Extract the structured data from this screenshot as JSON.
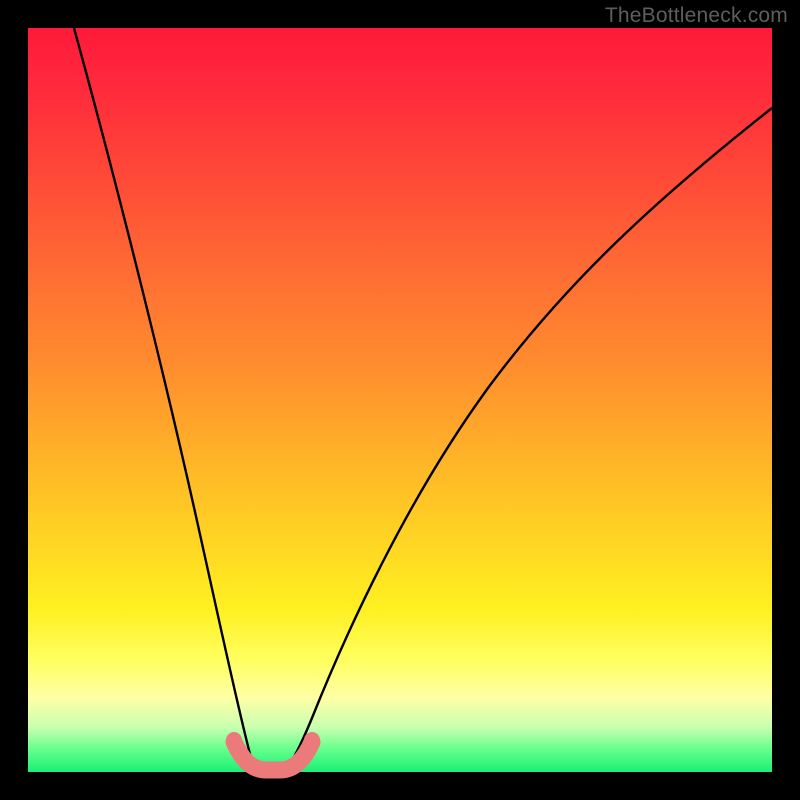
{
  "watermark": "TheBottleneck.com",
  "chart_data": {
    "type": "line",
    "title": "",
    "xlabel": "",
    "ylabel": "",
    "xlim": [
      0,
      1
    ],
    "ylim": [
      0,
      1
    ],
    "series": [
      {
        "name": "left-curve",
        "x": [
          0.06,
          0.09,
          0.12,
          0.15,
          0.18,
          0.21,
          0.235,
          0.26,
          0.28,
          0.295
        ],
        "y": [
          1.0,
          0.83,
          0.66,
          0.5,
          0.35,
          0.22,
          0.12,
          0.05,
          0.015,
          0.0
        ]
      },
      {
        "name": "right-curve",
        "x": [
          0.335,
          0.36,
          0.4,
          0.45,
          0.51,
          0.58,
          0.66,
          0.75,
          0.85,
          0.95,
          1.0
        ],
        "y": [
          0.0,
          0.06,
          0.17,
          0.3,
          0.42,
          0.53,
          0.63,
          0.72,
          0.8,
          0.865,
          0.895
        ]
      },
      {
        "name": "bottom-pink-band",
        "x": [
          0.275,
          0.29,
          0.31,
          0.33,
          0.35
        ],
        "y": [
          0.04,
          0.01,
          0.0,
          0.01,
          0.04
        ]
      }
    ],
    "colors": {
      "curve": "#000000",
      "bottom_band": "#f08080"
    }
  }
}
